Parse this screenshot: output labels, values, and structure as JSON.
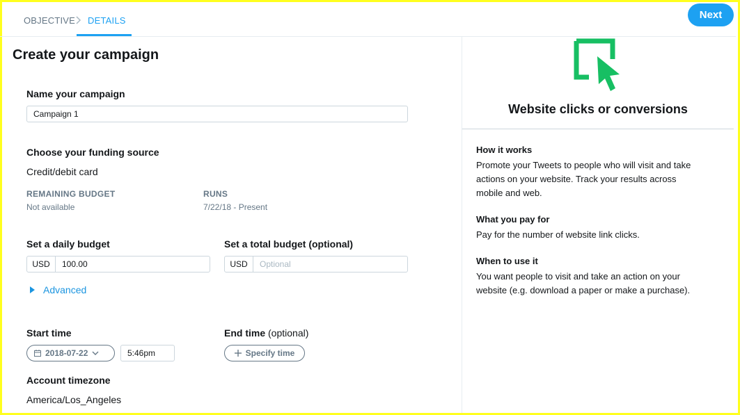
{
  "breadcrumb": {
    "objective": "OBJECTIVE",
    "details": "DETAILS"
  },
  "header": {
    "next_label": "Next"
  },
  "main": {
    "title": "Create your campaign",
    "name_label": "Name your campaign",
    "name_value": "Campaign 1",
    "funding_label": "Choose your funding source",
    "funding_value": "Credit/debit card",
    "remaining_budget_label": "REMAINING BUDGET",
    "remaining_budget_value": "Not available",
    "runs_label": "RUNS",
    "runs_value": "7/22/18 - Present",
    "daily_budget_label": "Set a daily budget",
    "daily_budget_currency": "USD",
    "daily_budget_value": "100.00",
    "total_budget_label": "Set a total budget (optional)",
    "total_budget_currency": "USD",
    "total_budget_placeholder": "Optional",
    "advanced_label": "Advanced",
    "start_time_label": "Start time",
    "start_date_value": "2018-07-22",
    "start_time_value": "5:46pm",
    "end_time_label": "End time",
    "end_time_optional": "(optional)",
    "specify_time_label": "Specify time",
    "timezone_label": "Account timezone",
    "timezone_value": "America/Los_Angeles"
  },
  "objective_panel": {
    "icon": "website-click-icon",
    "accent_color": "#17bf63",
    "title": "Website clicks or conversions",
    "how_it_works_heading": "How it works",
    "how_it_works_line1": "Promote your Tweets to people who will visit and take",
    "how_it_works_line2": "actions on your website. Track your results across",
    "how_it_works_line3": "mobile and web.",
    "what_you_pay_heading": "What you pay for",
    "what_you_pay_body": "Pay for the number of website link clicks.",
    "when_to_use_heading": "When to use it",
    "when_to_use_line1": "You want people to visit and take an action on your",
    "when_to_use_line2": "website (e.g. download a paper or make a purchase)."
  },
  "colors": {
    "brand_blue": "#1da1f2",
    "frame_highlight": "#ffff1e"
  }
}
